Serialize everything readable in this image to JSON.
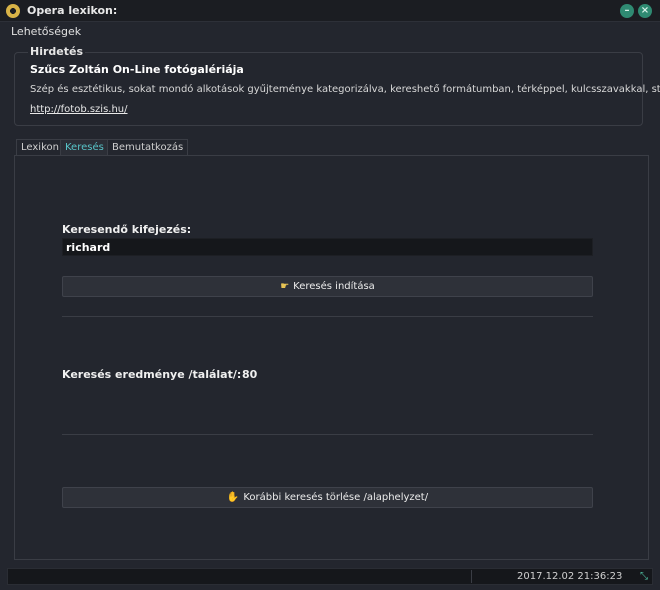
{
  "window": {
    "title": "Opera lexikon:",
    "minimize_glyph": "–",
    "close_glyph": "×"
  },
  "menu": {
    "options_label": "Lehetőségek"
  },
  "ad": {
    "legend": "Hirdetés",
    "title": "Szűcs Zoltán On-Line fotógalériája",
    "description": "Szép és esztétikus, sokat mondó alkotások gyűjteménye kategorizálva, kereshető formátumban, térképpel, kulcsszavakkal, stb...",
    "link": "http://fotob.szis.hu/"
  },
  "tabs": [
    {
      "label": "Lexikon",
      "active": false
    },
    {
      "label": "Keresés",
      "active": true
    },
    {
      "label": "Bemutatkozás",
      "active": false
    }
  ],
  "search": {
    "label": "Keresendő kifejezés:",
    "value": "richard",
    "start_button": "Keresés indítása",
    "result_label": "Keresés eredménye /találat/:",
    "result_count": "80",
    "reset_button": "Korábbi keresés törlése /alaphelyzet/"
  },
  "icons": {
    "start": "pointing-hand-icon",
    "reset": "hand-icon",
    "resize": "resize-icon"
  },
  "status": {
    "datetime": "2017.12.02 21:36:23"
  },
  "colors": {
    "background": "#23262e",
    "active_tab": "#58c5c9",
    "window_button": "#2f8a72"
  }
}
